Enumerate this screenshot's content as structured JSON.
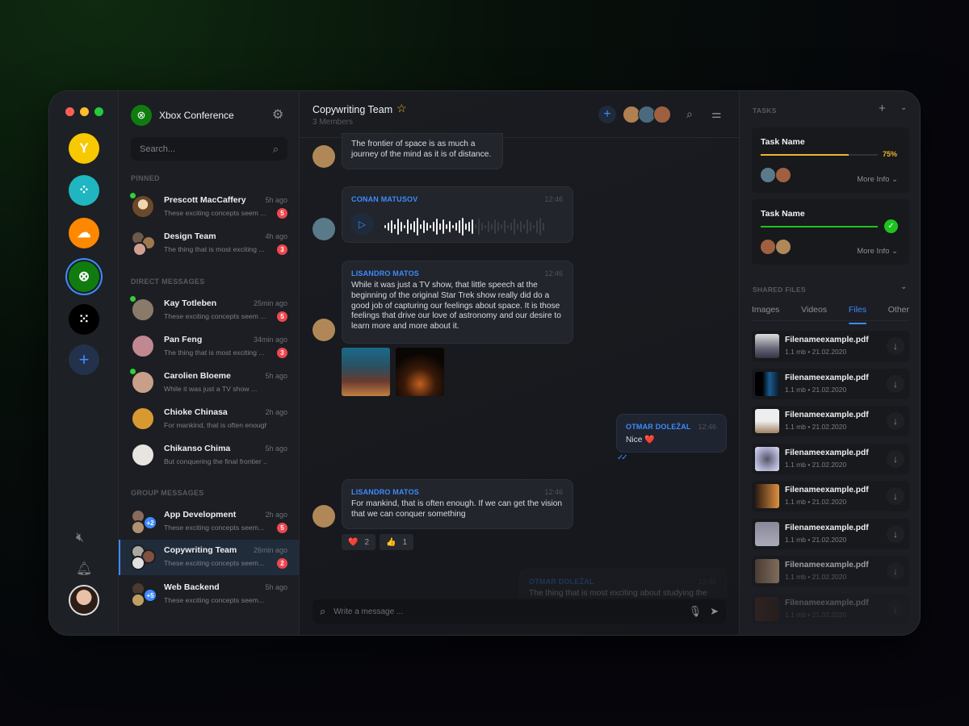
{
  "window_controls": {
    "close_color": "#fe5f57",
    "minimize_color": "#febc2e",
    "maximize_color": "#28c840"
  },
  "app_rail": {
    "apps": [
      {
        "name": "yammer",
        "color": "#f8c800",
        "glyph": "Y"
      },
      {
        "name": "fitbit",
        "color": "#1fb6c1",
        "glyph": "⁘"
      },
      {
        "name": "soundcloud",
        "color": "#ff8800",
        "glyph": "☁"
      },
      {
        "name": "xbox",
        "color": "#107c10",
        "glyph": "⊗",
        "selected": true
      },
      {
        "name": "blackberry",
        "color": "#000000",
        "glyph": "⁙"
      }
    ],
    "add_label": "+",
    "mute_icon": "🔇︎",
    "bell_icon": "🔔︎"
  },
  "workspace": {
    "name": "Xbox Conference",
    "search_placeholder": "Search..."
  },
  "sections": {
    "pinned": "PINNED",
    "direct": "DIRECT MESSAGES",
    "group": "GROUP MESSAGES"
  },
  "pinned": [
    {
      "name": "Prescott MacCaffery",
      "time": "5h ago",
      "preview": "These exciting concepts seem ...",
      "badge": "5",
      "online": true
    },
    {
      "name": "Design Team",
      "time": "4h ago",
      "preview": "The thing that is most exciting ...",
      "badge": "3",
      "online": false
    }
  ],
  "direct": [
    {
      "name": "Kay Totleben",
      "time": "25min ago",
      "preview": "These exciting concepts seem ...",
      "badge": "5",
      "online": true
    },
    {
      "name": "Pan Feng",
      "time": "34min ago",
      "preview": "The thing that is most exciting ...",
      "badge": "3",
      "online": false
    },
    {
      "name": "Carolien Bloeme",
      "time": "5h ago",
      "preview": "While it was just a TV show ...",
      "badge": "",
      "online": true
    },
    {
      "name": "Chioke Chinasa",
      "time": "2h ago",
      "preview": "For mankind, that is often enough ...",
      "badge": "",
      "online": false
    },
    {
      "name": "Chikanso Chima",
      "time": "5h ago",
      "preview": "But conquering the final frontier ...",
      "badge": "",
      "online": false
    }
  ],
  "group": [
    {
      "name": "App Development",
      "time": "2h ago",
      "preview": "These exciting concepts seem...",
      "badge": "5",
      "extra": "+2"
    },
    {
      "name": "Copywriting Team",
      "time": "26min ago",
      "preview": "These exciting concepts seem...",
      "badge": "2",
      "extra": "",
      "active": true
    },
    {
      "name": "Web Backend",
      "time": "5h ago",
      "preview": "These exciting concepts seem...",
      "badge": "",
      "extra": "+5"
    }
  ],
  "chat": {
    "title": "Copywriting Team",
    "members": "3 Members",
    "messages": [
      {
        "text": "The frontier of space is as much a journey of the mind as it is of distance."
      },
      {
        "sender": "CONAN MATUSOV",
        "time": "12:46",
        "type": "voice",
        "progress": 0.55
      },
      {
        "sender": "LISANDRO MATOS",
        "time": "12:46",
        "text": "While it was just a TV show, that little speech at the beginning of the original Star Trek show really did do a good job of capturing our feelings about space. It is those feelings that drive our love of astronomy and our desire to learn more and more about it."
      },
      {
        "sender": "OTMAR DOLEŽAL",
        "time": "12:46",
        "text": "Nice ❤️",
        "read": "✓✓"
      },
      {
        "sender": "LISANDRO MATOS",
        "time": "12:46",
        "text": "For mankind, that is often enough. If we can get the vision that we can conquer something"
      },
      {
        "sender": "OTMAR DOLEŽAL",
        "time": "12:46",
        "text": "The thing that is most exciting about studying the"
      }
    ],
    "reactions": [
      {
        "emoji": "❤️",
        "count": "2"
      },
      {
        "emoji": "👍",
        "count": "1"
      }
    ],
    "input_placeholder": "Write a message ..."
  },
  "tasks": {
    "heading": "TASKS",
    "items": [
      {
        "name": "Task Name",
        "progress": 0.75,
        "progress_label": "75%",
        "color": "#f1b52c",
        "more": "More Info"
      },
      {
        "name": "Task Name",
        "progress": 1.0,
        "progress_label": "",
        "color": "#1fc21f",
        "more": "More Info",
        "done": true
      }
    ]
  },
  "shared_files": {
    "heading": "SHARED FILES",
    "tabs": [
      "Images",
      "Videos",
      "Files",
      "Other"
    ],
    "active_tab": "Files",
    "files": [
      {
        "name": "Filenameexample.pdf",
        "size": "1.1 mb",
        "date": "21.02.2020"
      },
      {
        "name": "Filenameexample.pdf",
        "size": "1.1 mb",
        "date": "21.02.2020"
      },
      {
        "name": "Filenameexample.pdf",
        "size": "1.1 mb",
        "date": "21.02.2020"
      },
      {
        "name": "Filenameexample.pdf",
        "size": "1.1 mb",
        "date": "21.02.2020"
      },
      {
        "name": "Filenameexample.pdf",
        "size": "1.1 mb",
        "date": "21.02.2020"
      },
      {
        "name": "Filenameexample.pdf",
        "size": "1.1 mb",
        "date": "21.02.2020"
      },
      {
        "name": "Filenameexample.pdf",
        "size": "1.1 mb",
        "date": "21.02.2020"
      },
      {
        "name": "Filenameexample.pdf",
        "size": "1.1 mb",
        "date": "21.02.2020"
      }
    ]
  }
}
